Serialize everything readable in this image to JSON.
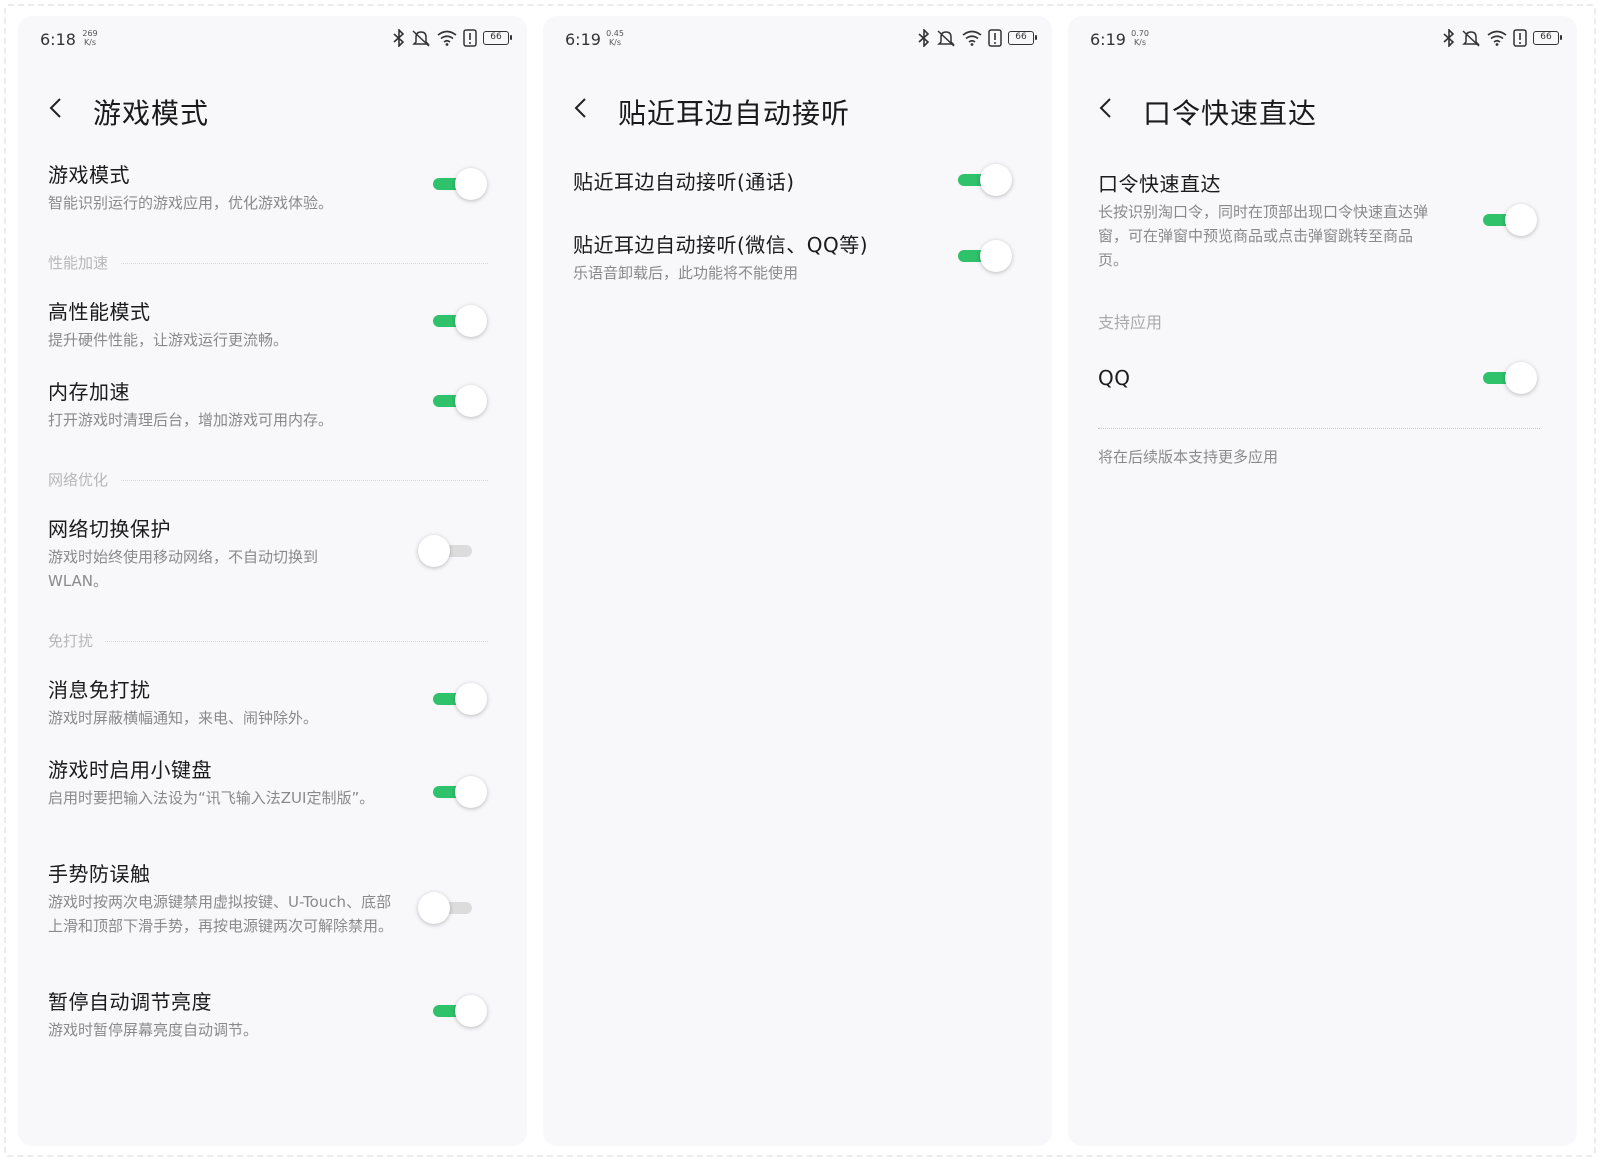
{
  "colors": {
    "accent": "#2fc26a",
    "panel_bg": "#f8f7fa"
  },
  "panel1": {
    "status": {
      "time": "6:18",
      "speed_value": "269",
      "speed_unit": "K/s",
      "battery": "66"
    },
    "title": "游戏模式",
    "items": [
      {
        "label": "游戏模式",
        "desc": "智能识别运行的游戏应用，优化游戏体验。",
        "on": true
      },
      {
        "label": "高性能模式",
        "desc": "提升硬件性能，让游戏运行更流畅。",
        "on": true
      },
      {
        "label": "内存加速",
        "desc": "打开游戏时清理后台，增加游戏可用内存。",
        "on": true
      },
      {
        "label": "网络切换保护",
        "desc": "游戏时始终使用移动网络，不自动切换到WLAN。",
        "on": false
      },
      {
        "label": "消息免打扰",
        "desc": "游戏时屏蔽横幅通知，来电、闹钟除外。",
        "on": true
      },
      {
        "label": "游戏时启用小键盘",
        "desc": "启用时要把输入法设为“讯飞输入法ZUI定制版”。",
        "on": true
      },
      {
        "label": "手势防误触",
        "desc": "游戏时按两次电源键禁用虚拟按键、U-Touch、底部上滑和顶部下滑手势，再按电源键两次可解除禁用。",
        "on": false
      },
      {
        "label": "暂停自动调节亮度",
        "desc": "游戏时暂停屏幕亮度自动调节。",
        "on": true
      }
    ],
    "sections": [
      "性能加速",
      "网络优化",
      "免打扰"
    ]
  },
  "panel2": {
    "status": {
      "time": "6:19",
      "speed_value": "0.45",
      "speed_unit": "K/s",
      "battery": "66"
    },
    "title": "贴近耳边自动接听",
    "items": [
      {
        "label": "贴近耳边自动接听(通话)",
        "on": true
      },
      {
        "label": "贴近耳边自动接听(微信、QQ等)",
        "desc": "乐语音卸载后，此功能将不能使用",
        "on": true
      }
    ]
  },
  "panel3": {
    "status": {
      "time": "6:19",
      "speed_value": "0.70",
      "speed_unit": "K/s",
      "battery": "66"
    },
    "title": "口令快速直达",
    "main": {
      "label": "口令快速直达",
      "desc": "长按识别淘口令，同时在顶部出现口令快速直达弹窗，可在弹窗中预览商品或点击弹窗跳转至商品页。",
      "on": true
    },
    "section": "支持应用",
    "apps": [
      {
        "label": "QQ",
        "on": true
      }
    ],
    "note": "将在后续版本支持更多应用"
  }
}
